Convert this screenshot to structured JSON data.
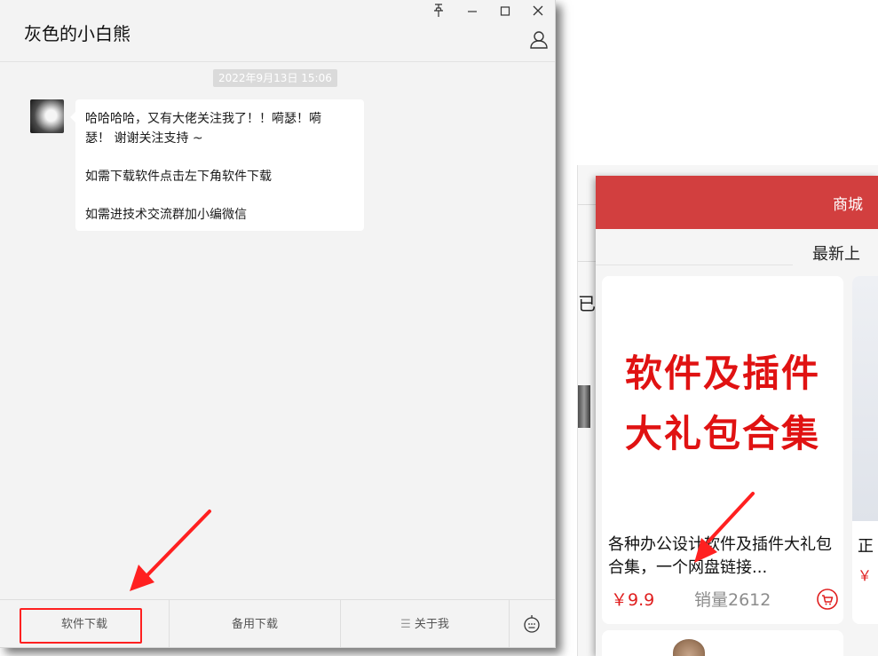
{
  "chat": {
    "title": "灰色的小白熊",
    "window_controls": {
      "pin": "푸",
      "minimize": "—",
      "maximize": "☐",
      "close": "✕"
    },
    "timestamp": "2022年9月13日 15:06",
    "message": {
      "line1": "哈哈哈哈，又有大佬关注我了！！嗬瑟！嗬",
      "line2": "瑟！   谢谢关注支持 ~",
      "line3": "如需下载软件点击左下角软件下载",
      "line4": "如需进技术交流群加小编微信"
    },
    "footer_menu": [
      {
        "label": "软件下载"
      },
      {
        "label": "备用下载"
      },
      {
        "label": "关于我",
        "glyph": "☰"
      }
    ]
  },
  "shop": {
    "header_title": "商城",
    "subnav_label": "最新上",
    "bg_peek_text": "已",
    "product": {
      "image_text_line1": "软件及插件",
      "image_text_line2": "大礼包合集",
      "name": "各种办公设计软件及插件大礼包合集，一个网盘链接...",
      "price": "￥9.9",
      "sales": "销量2612"
    },
    "next_card": {
      "name_peek": "正",
      "price_peek": "￥"
    }
  },
  "colors": {
    "accent_red": "#d23f3f",
    "price_red": "#e01e1e",
    "highlight_red": "#ff2020",
    "chat_bg": "#f3f3f3"
  }
}
